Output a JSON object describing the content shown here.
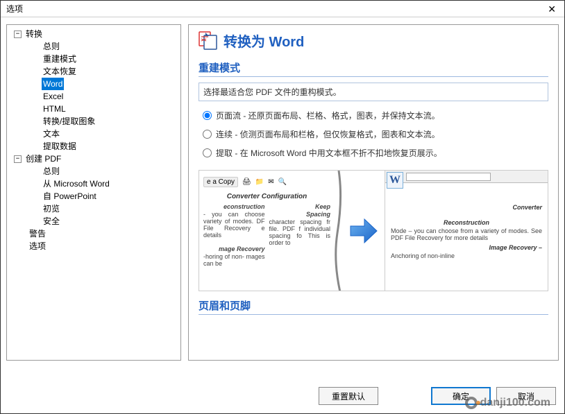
{
  "window": {
    "title": "选项"
  },
  "tree": {
    "root": {
      "label": "转换",
      "expanded": true
    },
    "children_first": [
      {
        "label": "总则"
      },
      {
        "label": "重建模式"
      },
      {
        "label": "文本恢复"
      },
      {
        "label": "Word",
        "selected": true
      },
      {
        "label": "Excel"
      },
      {
        "label": "HTML"
      },
      {
        "label": "转换/提取图象"
      },
      {
        "label": "文本"
      },
      {
        "label": "提取数据"
      }
    ],
    "root2": {
      "label": "创建 PDF",
      "expanded": true
    },
    "children_second": [
      {
        "label": "总则"
      },
      {
        "label": "从 Microsoft Word"
      },
      {
        "label": "自 PowerPoint"
      },
      {
        "label": "初览"
      },
      {
        "label": "安全"
      }
    ],
    "siblings": [
      {
        "label": "警告"
      },
      {
        "label": "选项"
      }
    ]
  },
  "main": {
    "title": "转换为 Word",
    "section_rebuild": "重建模式",
    "desc": "选择最适合您 PDF 文件的重构模式。",
    "radios": {
      "flow": "页面流 - 还原页面布局、栏格、格式，图表，并保持文本流。",
      "cont": "连续 - 侦测页面布局和栏格，但仅恢复格式，图表和文本流。",
      "extract": "提取 - 在 Microsoft Word 中用文本框不折不扣地恢复页展示。"
    },
    "section_header": "页眉和页脚"
  },
  "preview": {
    "copy_btn": "e a Copy",
    "conf_heading": "Converter Configuration",
    "left_col": {
      "h1": "econstruction",
      "l1": "- you can choose",
      "l2": "variety of modes.",
      "l3": "DF File Recovery",
      "l4": "e details",
      "h2": "mage Recovery",
      "l5": "-horing of non-",
      "l6": "mages can be"
    },
    "right_col": {
      "h1": "Keep",
      "h2": "Spacing",
      "l1": "character",
      "l2": "spacing fr",
      "l3": "file. PDF f",
      "l4": "individual",
      "l5": "spacing fo",
      "l6": "This is",
      "l7": "order to"
    },
    "word_side": {
      "heading": "Converter",
      "h1": "Reconstruction",
      "l1": "Mode – you can choose",
      "l2": "from a variety of modes.",
      "l3": "See PDF File Recovery",
      "l4": "for more details",
      "h2": "Image Recovery –",
      "l5": "Anchoring of non-inline"
    },
    "word_icon": "W"
  },
  "buttons": {
    "reset": "重置默认",
    "ok": "确定",
    "cancel": "取消"
  },
  "watermark": "danji100.com"
}
